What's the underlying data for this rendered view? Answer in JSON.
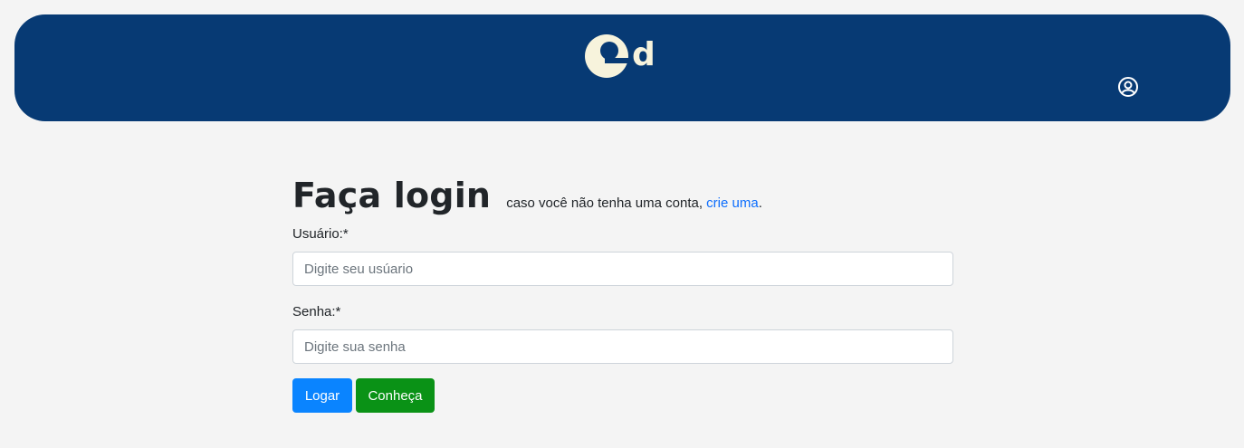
{
  "header": {
    "logo_alt": "ed",
    "logo_text": "d",
    "colors": {
      "background": "#073a74",
      "logo": "#f7f3dc"
    },
    "user_icon": "user-circle-icon"
  },
  "login": {
    "title": "Faça login",
    "subtitle_prefix": "caso você não tenha uma conta, ",
    "subtitle_link": "crie uma",
    "subtitle_suffix": ".",
    "username_label": "Usuário:*",
    "username_placeholder": "Digite seu usúario",
    "password_label": "Senha:*",
    "password_placeholder": "Digite sua senha",
    "login_button": "Logar",
    "discover_button": "Conheça",
    "colors": {
      "link": "#0d6efd",
      "primary": "#0a84ff",
      "success": "#0a9216"
    }
  }
}
